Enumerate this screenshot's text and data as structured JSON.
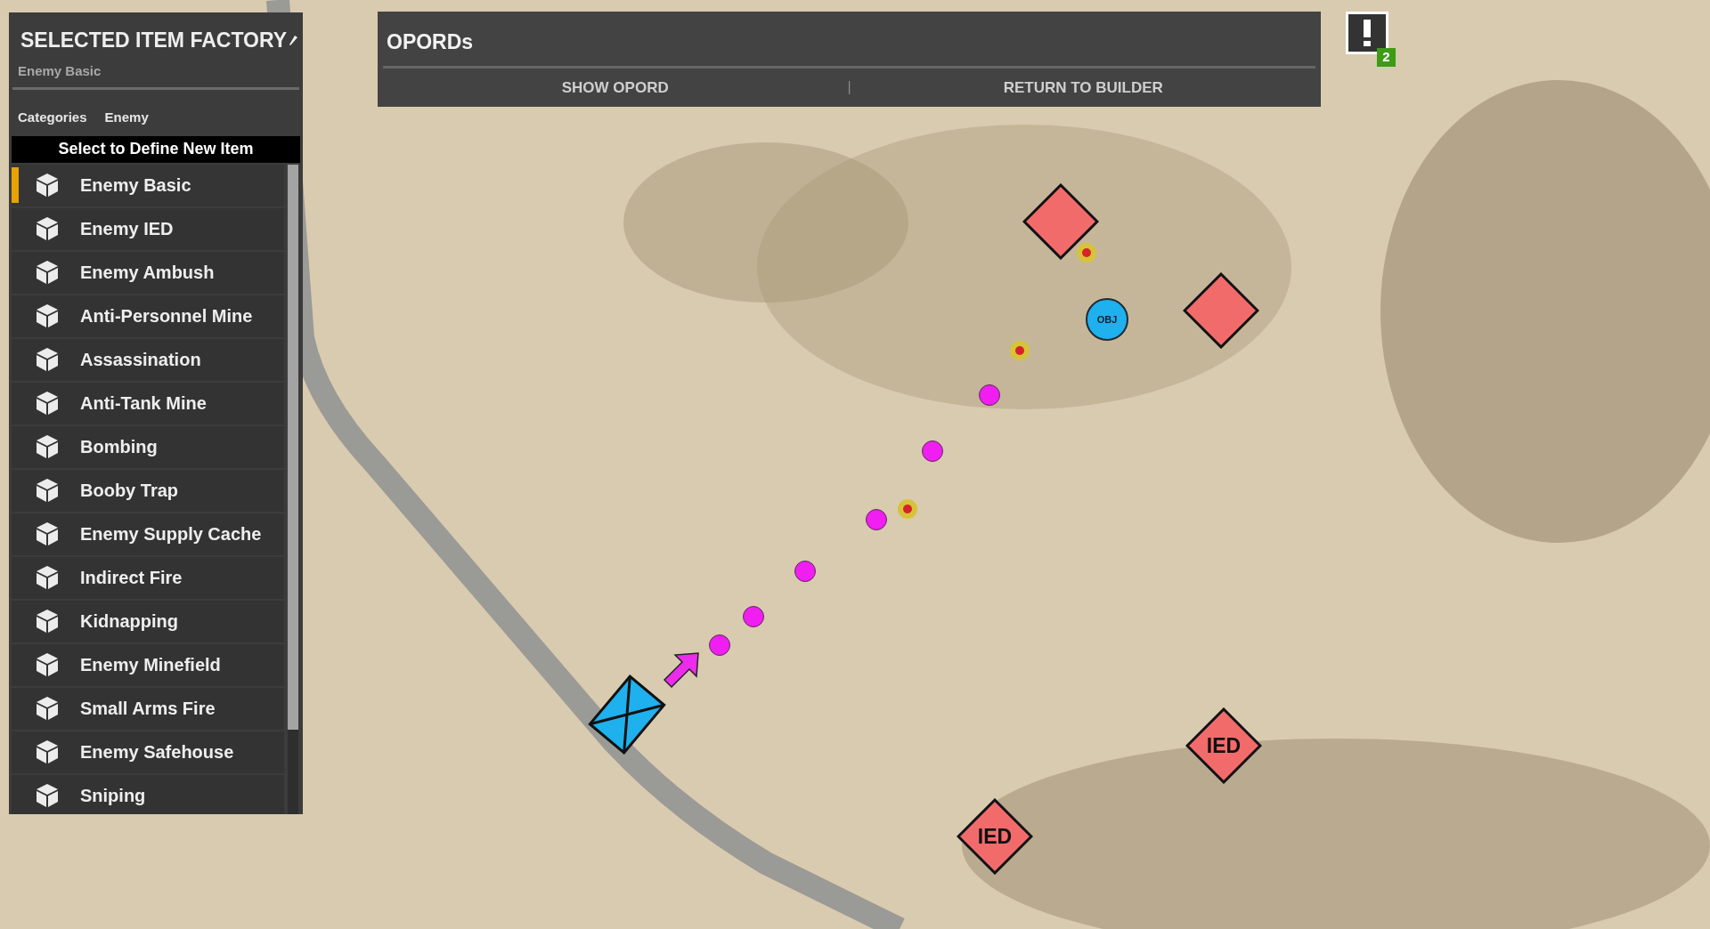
{
  "factory_panel": {
    "title": "SELECTED ITEM FACTORY",
    "subtitle": "Enemy Basic",
    "breadcrumbs": [
      "Categories",
      "Enemy"
    ],
    "list_header": "Select to Define New Item",
    "items": [
      {
        "label": "Enemy Basic",
        "selected": true
      },
      {
        "label": "Enemy IED",
        "selected": false
      },
      {
        "label": "Enemy Ambush",
        "selected": false
      },
      {
        "label": "Anti-Personnel Mine",
        "selected": false
      },
      {
        "label": "Assassination",
        "selected": false
      },
      {
        "label": "Anti-Tank Mine",
        "selected": false
      },
      {
        "label": "Bombing",
        "selected": false
      },
      {
        "label": "Booby Trap",
        "selected": false
      },
      {
        "label": "Enemy Supply Cache",
        "selected": false
      },
      {
        "label": "Indirect Fire",
        "selected": false
      },
      {
        "label": "Kidnapping",
        "selected": false
      },
      {
        "label": "Enemy Minefield",
        "selected": false
      },
      {
        "label": "Small Arms Fire",
        "selected": false
      },
      {
        "label": "Enemy Safehouse",
        "selected": false
      },
      {
        "label": "Sniping",
        "selected": false
      }
    ]
  },
  "opords_bar": {
    "title": "OPORDs",
    "buttons": [
      "SHOW OPORD",
      "RETURN TO BUILDER"
    ],
    "separator": "|"
  },
  "alerts": {
    "count": "2"
  },
  "map": {
    "markers": [
      {
        "kind": "hostile"
      },
      {
        "kind": "hostile"
      },
      {
        "kind": "objective",
        "label": "OBJ"
      },
      {
        "kind": "hostile",
        "label": "IED"
      },
      {
        "kind": "hostile",
        "label": "IED"
      },
      {
        "kind": "friendly"
      },
      {
        "kind": "arrow"
      },
      {
        "kind": "waypoint"
      },
      {
        "kind": "waypoint"
      },
      {
        "kind": "waypoint"
      },
      {
        "kind": "waypoint"
      },
      {
        "kind": "waypoint"
      },
      {
        "kind": "waypoint"
      },
      {
        "kind": "target"
      },
      {
        "kind": "target"
      },
      {
        "kind": "target"
      }
    ]
  }
}
